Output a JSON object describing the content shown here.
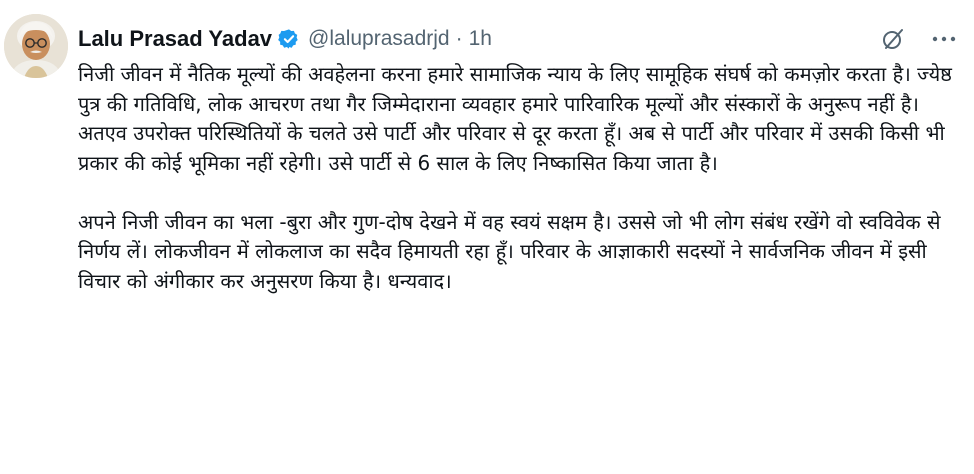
{
  "author": {
    "name": "Lalu Prasad Yadav",
    "handle": "@laluprasadrjd",
    "separator": "·",
    "time": "1h",
    "verified": true
  },
  "icons": {
    "verified": "verified-badge-icon",
    "grok": "grok-icon",
    "more": "more-options-icon"
  },
  "colors": {
    "verified_blue": "#1d9bf0",
    "text_primary": "#0f1419",
    "text_secondary": "#536471"
  },
  "tweet": {
    "paragraph_1": "निजी जीवन में नैतिक मूल्यों की अवहेलना करना हमारे सामाजिक न्याय के लिए सामूहिक संघर्ष को कमज़ोर करता है। ज्येष्ठ पुत्र की गतिविधि, लोक आचरण तथा गैर जिम्मेदाराना व्यवहार हमारे पारिवारिक मूल्यों और संस्कारों के अनुरूप नहीं है। अतएव उपरोक्त परिस्थितियों के चलते उसे पार्टी और परिवार से दूर करता हूँ। अब से पार्टी और परिवार में उसकी किसी भी प्रकार की कोई भूमिका नहीं रहेगी। उसे पार्टी से 6 साल के लिए निष्कासित किया जाता है।",
    "paragraph_2": "अपने निजी जीवन का भला -बुरा और गुण-दोष देखने में वह स्वयं सक्षम है। उससे जो भी लोग संबंध रखेंगे वो स्वविवेक से निर्णय लें। लोकजीवन में लोकलाज का सदैव हिमायती रहा हूँ। परिवार के आज्ञाकारी सदस्यों ने सार्वजनिक जीवन में इसी विचार को अंगीकार कर अनुसरण किया है। धन्यवाद।"
  }
}
